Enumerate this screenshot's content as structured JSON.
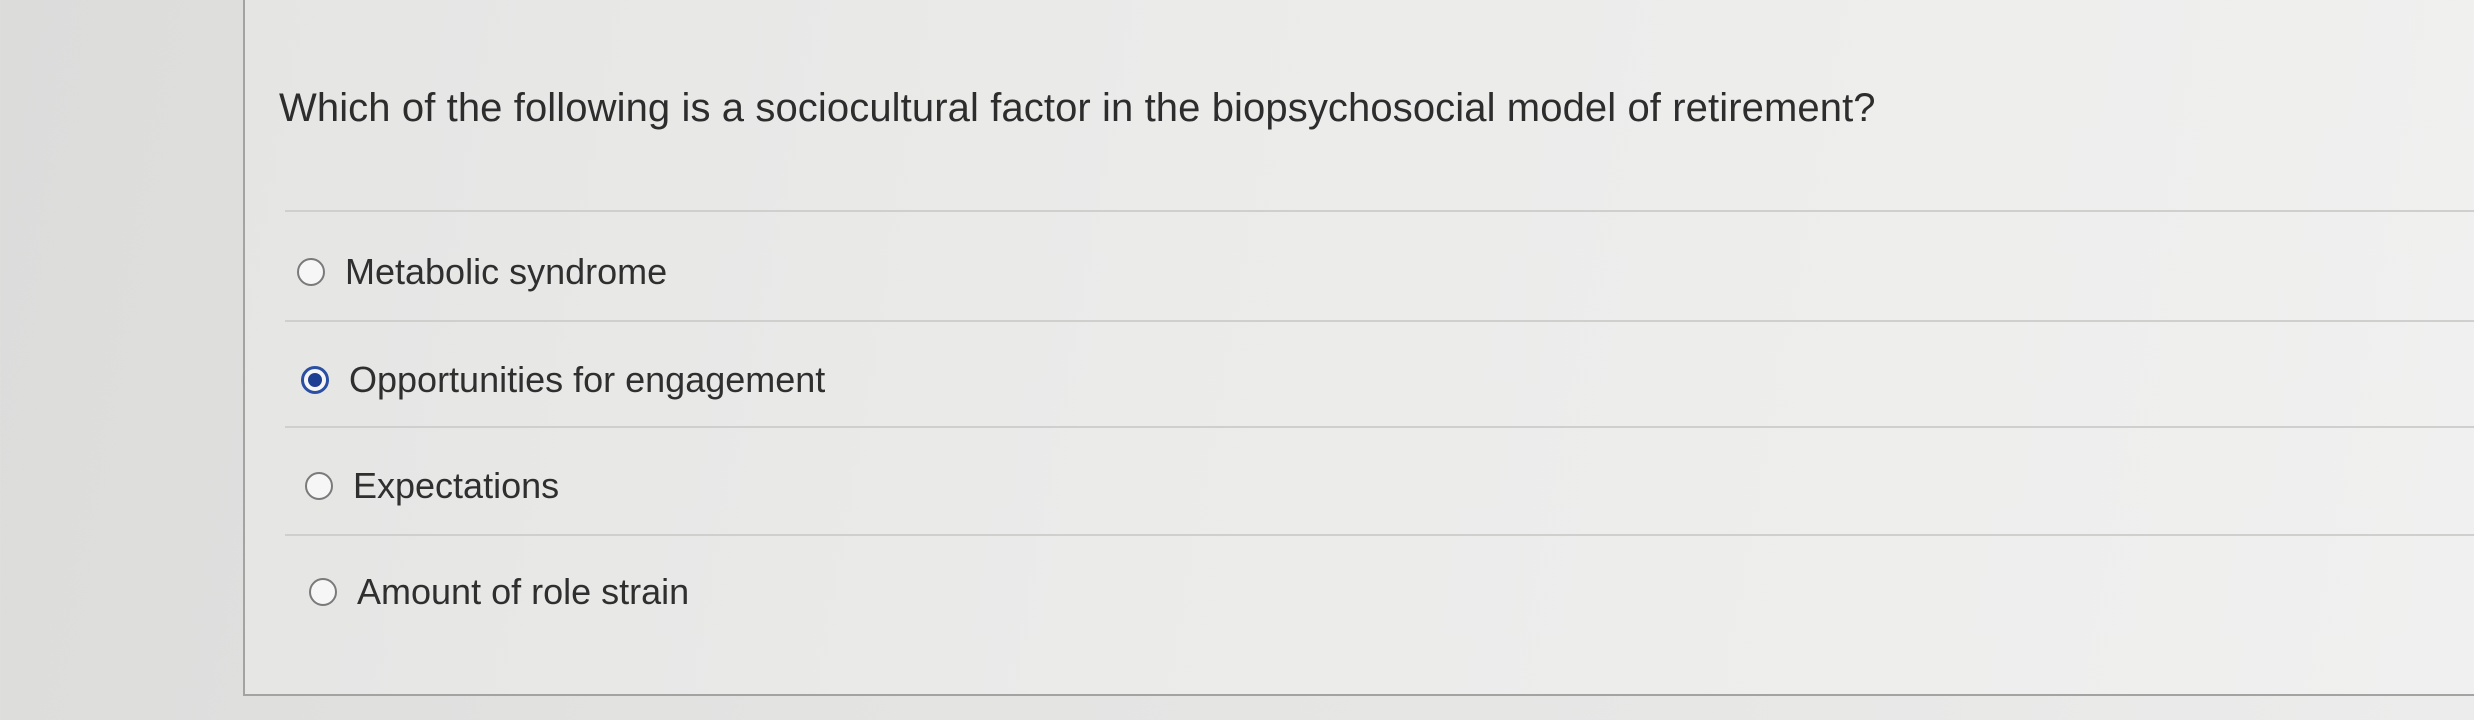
{
  "question": {
    "text": "Which of the following is a sociocultural factor in the biopsychosocial model of retirement?"
  },
  "options": [
    {
      "label": "Metabolic syndrome",
      "selected": false
    },
    {
      "label": "Opportunities for engagement",
      "selected": true
    },
    {
      "label": "Expectations",
      "selected": false
    },
    {
      "label": "Amount of role strain",
      "selected": false
    }
  ],
  "colors": {
    "selected_radio": "#1c3f93",
    "text": "#2f2f2f"
  }
}
